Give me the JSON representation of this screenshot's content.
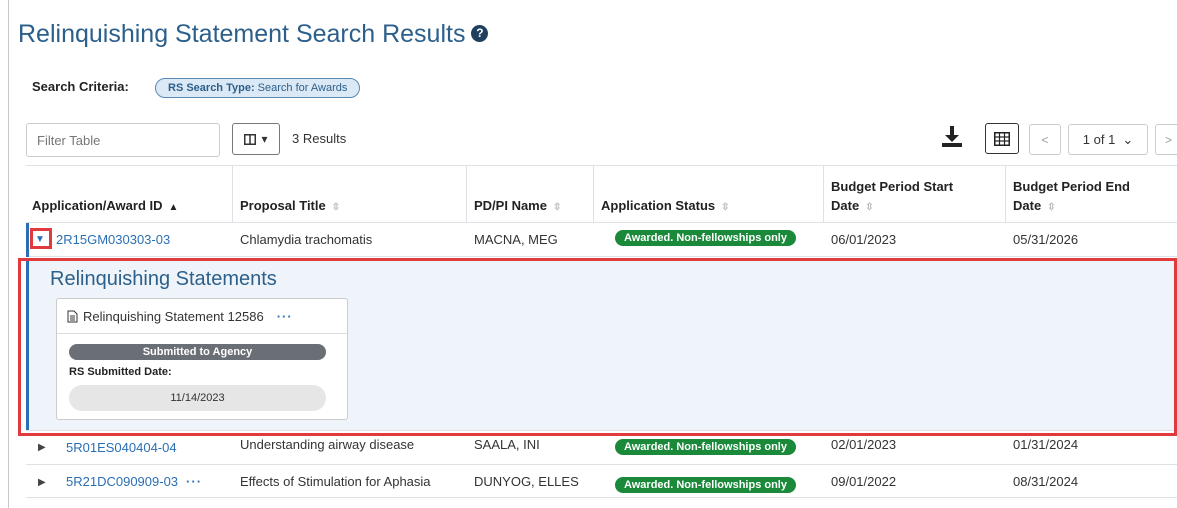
{
  "page": {
    "title": "Relinquishing Statement Search Results",
    "help_icon": "question-circle-icon"
  },
  "search_criteria": {
    "label": "Search Criteria:",
    "pill_key": "RS Search Type:",
    "pill_value": "Search for Awards"
  },
  "toolbar": {
    "filter_placeholder": "Filter Table",
    "results_text": "3 Results",
    "download_icon": "download-icon",
    "grid_icon": "table-grid-icon",
    "pagination": {
      "prev": "<",
      "page": "1 of 1",
      "next": ">"
    }
  },
  "table": {
    "headers": [
      "Application/Award ID",
      "Proposal Title",
      "PD/PI Name",
      "Application Status",
      "Budget Period Start Date",
      "Budget Period End Date"
    ],
    "rows": [
      {
        "id": "2R15GM030303-03",
        "title": "Chlamydia trachomatis",
        "pi": "MACNA, MEG",
        "status": "Awarded. Non-fellowships only",
        "start": "06/01/2023",
        "end": "05/31/2026",
        "expanded": true
      },
      {
        "id": "5R01ES040404-04",
        "title": "Understanding airway disease",
        "pi": "SAALA, INI",
        "status": "Awarded. Non-fellowships only",
        "start": "02/01/2023",
        "end": "01/31/2024",
        "expanded": false
      },
      {
        "id": "5R21DC090909-03",
        "title": "Effects of Stimulation for Aphasia",
        "pi": "DUNYOG, ELLES",
        "status": "Awarded. Non-fellowships only",
        "start": "09/01/2022",
        "end": "08/31/2024",
        "expanded": false,
        "has_menu": true
      }
    ]
  },
  "expanded_panel": {
    "title": "Relinquishing Statements",
    "card": {
      "heading": "Relinquishing Statement 12586",
      "menu": "···",
      "status": "Submitted to Agency",
      "date_label": "RS Submitted Date:",
      "date_value": "11/14/2023"
    }
  },
  "colors": {
    "brand_blue": "#2c5f8a",
    "link_blue": "#2a6fb5",
    "status_green": "#1a8a3a",
    "highlight_red": "#e03a3e"
  }
}
